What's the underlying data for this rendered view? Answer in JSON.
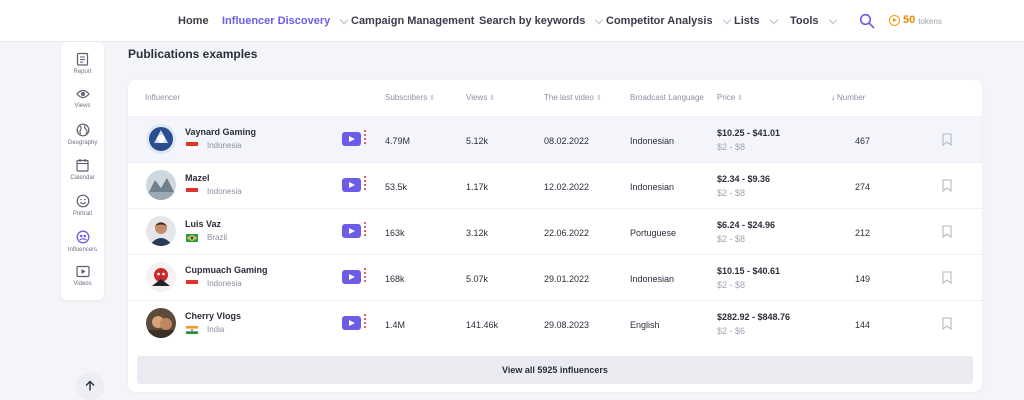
{
  "nav": {
    "items": [
      {
        "label": "Home",
        "active": false,
        "dropdown": false
      },
      {
        "label": "Influencer Discovery",
        "active": true,
        "dropdown": true
      },
      {
        "label": "Campaign Management",
        "active": false,
        "dropdown": false
      },
      {
        "label": "Search by keywords",
        "active": false,
        "dropdown": true
      },
      {
        "label": "Competitor Analysis",
        "active": false,
        "dropdown": true
      },
      {
        "label": "Lists",
        "active": false,
        "dropdown": true
      },
      {
        "label": "Tools",
        "active": false,
        "dropdown": true
      }
    ],
    "tokens_value": "50",
    "tokens_unit": "tokens"
  },
  "sidebar": {
    "items": [
      {
        "label": "Report",
        "icon": "report-icon"
      },
      {
        "label": "Views",
        "icon": "eye-icon"
      },
      {
        "label": "Geography",
        "icon": "globe-icon"
      },
      {
        "label": "Calendar",
        "icon": "calendar-icon"
      },
      {
        "label": "Portrait",
        "icon": "smile-icon"
      },
      {
        "label": "Influencers",
        "icon": "influencers-icon",
        "active": true
      },
      {
        "label": "Videos",
        "icon": "video-icon"
      }
    ]
  },
  "main": {
    "section_title": "Publications examples",
    "columns": {
      "influencer": "Influencer",
      "subscribers": "Subscribers",
      "views": "Views",
      "last_video": "The last video",
      "language": "Broadcast Language",
      "price": "Price",
      "number": "Number"
    },
    "rows": [
      {
        "name": "Vaynard Gaming",
        "country": "Indonesia",
        "flag": "indonesia",
        "subscribers": "4.79M",
        "views": "5.12k",
        "last_video": "08.02.2022",
        "language": "Indonesian",
        "price": "$10.25 - $41.01",
        "price_alt": "$2 - $8",
        "number": "467"
      },
      {
        "name": "Mazel",
        "country": "Indonesia",
        "flag": "indonesia",
        "subscribers": "53.5k",
        "views": "1.17k",
        "last_video": "12.02.2022",
        "language": "Indonesian",
        "price": "$2.34 - $9.36",
        "price_alt": "$2 - $8",
        "number": "274"
      },
      {
        "name": "Luis Vaz",
        "country": "Brazil",
        "flag": "brazil",
        "subscribers": "163k",
        "views": "3.12k",
        "last_video": "22.06.2022",
        "language": "Portuguese",
        "price": "$6.24 - $24.96",
        "price_alt": "$2 - $8",
        "number": "212"
      },
      {
        "name": "Cupmuach Gaming",
        "country": "Indonesia",
        "flag": "indonesia",
        "subscribers": "168k",
        "views": "5.07k",
        "last_video": "29.01.2022",
        "language": "Indonesian",
        "price": "$10.15 - $40.61",
        "price_alt": "$2 - $8",
        "number": "149"
      },
      {
        "name": "Cherry Vlogs",
        "country": "India",
        "flag": "india",
        "subscribers": "1.4M",
        "views": "141.46k",
        "last_video": "29.08.2023",
        "language": "English",
        "price": "$282.92 - $848.76",
        "price_alt": "$2 - $6",
        "number": "144"
      }
    ],
    "view_all_label": "View all 5925 influencers"
  },
  "colors": {
    "accent": "#6c5ce7",
    "token": "#f39c12",
    "indonesia_red": "#e03131",
    "brazil_green": "#2f9e44",
    "brazil_yellow": "#ffd43b",
    "india_saffron": "#ff922b",
    "india_green": "#2b8a3e"
  }
}
